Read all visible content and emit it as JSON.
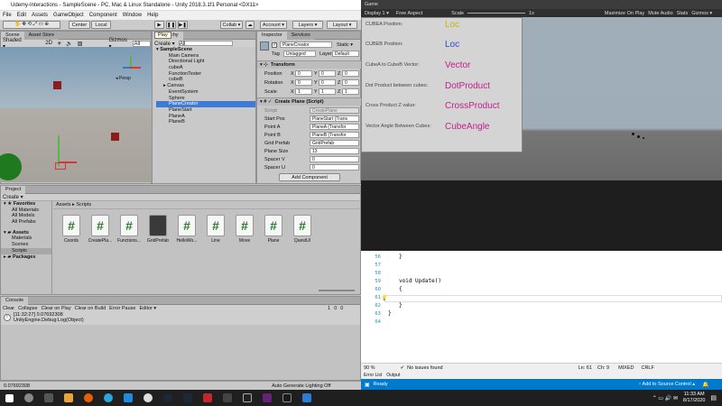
{
  "window": {
    "title": "Udemy-Interactions - SampleScene - PC, Mac & Linux Standalone - Unity 2018.3.1f1 Personal <DX11>"
  },
  "menu": [
    "File",
    "Edit",
    "Assets",
    "GameObject",
    "Component",
    "Window",
    "Help"
  ],
  "toolbar": {
    "center": "Center",
    "local": "Local",
    "collab": "Collab ▾",
    "cloud": "☁",
    "account": "Account ▾",
    "layers": "Layers ▾",
    "layout": "Layout ▾",
    "tooltip": "Play"
  },
  "scene": {
    "tabs": [
      "Scene",
      "Asset Store"
    ],
    "shaded": "Shaded ▾",
    "mode": "2D",
    "gizmos": "Gizmos ▾",
    "search": "All",
    "persp": "◂ Persp"
  },
  "hierarchy": {
    "tab": "Hierarchy",
    "create": "Create ▾",
    "search": "All",
    "items": [
      "SampleScene",
      "Main Camera",
      "Directional Light",
      "cubeA",
      "FunctionTester",
      "cubeB",
      "Canvas",
      "EventSystem",
      "Sphere",
      "PlaneCreator",
      "PlaneStart",
      "PlaneA",
      "PlaneB"
    ]
  },
  "inspector": {
    "tabs": [
      "Inspector",
      "Services"
    ],
    "name": "PlaneCreator",
    "static": "Static ▾",
    "tag": "Tag",
    "tag_val": "Untagged",
    "layer": "Layer",
    "layer_val": "Default",
    "transform": "Transform",
    "pos": [
      "Position",
      "X",
      "0",
      "Y",
      "0",
      "Z",
      "0"
    ],
    "rot": [
      "Rotation",
      "X",
      "0",
      "Y",
      "0",
      "Z",
      "0"
    ],
    "scale": [
      "Scale",
      "X",
      "1",
      "Y",
      "1",
      "Z",
      "1"
    ],
    "script_title": "Create Plane (Script)",
    "fields": [
      {
        "label": "Script",
        "value": "CreatePlane"
      },
      {
        "label": "Start Pos",
        "value": "PlaneStart (Trans"
      },
      {
        "label": "Point A",
        "value": "PlaneA (Transfor"
      },
      {
        "label": "Point B",
        "value": "PlaneB (Transfor"
      },
      {
        "label": "Grid Prefab",
        "value": "GridPrefab"
      },
      {
        "label": "Plane Size",
        "value": "13"
      },
      {
        "label": "Spacer V",
        "value": "0"
      },
      {
        "label": "Spacer U",
        "value": "0"
      }
    ],
    "add_component": "Add Component"
  },
  "project": {
    "tabs": [
      "Project"
    ],
    "create": "Create ▾",
    "favorites": "Favorites",
    "fav_items": [
      "All Materials",
      "All Models",
      "All Prefabs"
    ],
    "assets": "Assets",
    "asset_items": [
      "Materials",
      "Scenes",
      "Scripts"
    ],
    "packages": "Packages",
    "breadcrumb": "Assets ▸ Scripts",
    "files": [
      "Coords",
      "CreatePla...",
      "Functions...",
      "GridPrefab",
      "HelloWo...",
      "Line",
      "Move",
      "Plane",
      "QuestUI"
    ]
  },
  "console": {
    "tab": "Console",
    "buttons": [
      "Clear",
      "Collapse",
      "Clear on Play",
      "Clear on Build",
      "Error Pause",
      "Editor ▾"
    ],
    "counts": [
      "1",
      "0",
      "0"
    ],
    "entry_line1": "[11:32:27] 0.07692308",
    "entry_line2": "UnityEngine.Debug:Log(Object)",
    "status": "0.07692308",
    "lighting": "Auto Generate Lighting Off"
  },
  "game": {
    "tab": "Game",
    "display": "Display 1 ▾",
    "aspect": "Free Aspect",
    "scale_label": "Scale",
    "scale_val": "1x",
    "opts": [
      "Maximize On Play",
      "Mute Audio",
      "Stats",
      "Gizmos ▾"
    ],
    "rows": [
      {
        "label": "CUBEA Position:",
        "value": "Loc",
        "color": "#c8b400"
      },
      {
        "label": "CUBEB Position:",
        "value": "Loc",
        "color": "#2b4fc2"
      },
      {
        "label": "CubeA to CubeB Vector:",
        "value": "Vector",
        "color": "#c21e8e"
      },
      {
        "label": "Dot Product between cubes:",
        "value": "DotProduct",
        "color": "#c21e8e"
      },
      {
        "label": "Cross Product Z value:",
        "value": "CrossProduct",
        "color": "#c21e8e"
      },
      {
        "label": "Vector Angle Between Cubes:",
        "value": "CubeAngle",
        "color": "#c21e8e"
      }
    ]
  },
  "code": {
    "lines": [
      [
        "56",
        "}"
      ],
      [
        "57",
        ""
      ],
      [
        "58",
        ""
      ],
      [
        "59",
        "void Update()"
      ],
      [
        "60",
        "{"
      ],
      [
        "61",
        ""
      ],
      [
        "62",
        "}"
      ],
      [
        "63",
        "}"
      ],
      [
        "64",
        ""
      ]
    ],
    "zoom": "90 %",
    "issues": "No issues found",
    "pos": "Ln: 61",
    "col": "Ch: 9",
    "mode": "MIXED",
    "crlf": "CRLF",
    "tabs": [
      "Error List",
      "Output"
    ]
  },
  "vsstatus": {
    "ready": "Ready",
    "source": "↑ Add to Source Control ▴"
  },
  "taskbar": {
    "time": "11:33 AM",
    "date": "8/17/2020"
  }
}
